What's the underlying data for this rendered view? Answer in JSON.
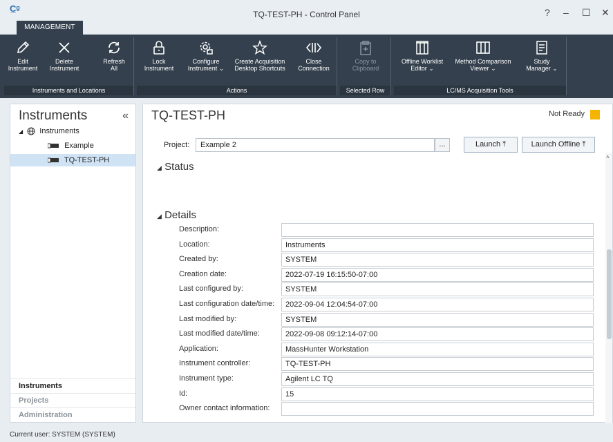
{
  "window": {
    "title": "TQ-TEST-PH - Control Panel",
    "help": "?",
    "minimize": "–",
    "maximize": "☐",
    "close": "✕"
  },
  "ribbon_tab": "MANAGEMENT",
  "ribbon": {
    "groups": [
      {
        "label": "Instruments and Locations"
      },
      {
        "label": "Actions"
      },
      {
        "label": "Selected Row"
      },
      {
        "label": "LC/MS Acquisition Tools"
      }
    ],
    "buttons": {
      "edit": [
        "Edit",
        "Instrument"
      ],
      "delete": [
        "Delete",
        "Instrument"
      ],
      "refresh": [
        "Refresh",
        "All"
      ],
      "lock": [
        "Lock",
        "Instrument"
      ],
      "configure": [
        "Configure",
        "Instrument ⌄"
      ],
      "shortcuts": [
        "Create Acquisition",
        "Desktop Shortcuts"
      ],
      "close_conn": [
        "Close",
        "Connection"
      ],
      "copy": [
        "Copy to",
        "Clipboard"
      ],
      "worklist": [
        "Offline Worklist",
        "Editor ⌄"
      ],
      "method_cmp": [
        "Method Comparison",
        "Viewer ⌄"
      ],
      "study": [
        "Study",
        "Manager ⌄"
      ]
    }
  },
  "left": {
    "title": "Instruments",
    "collapse": "«",
    "tree": {
      "root": "Instruments",
      "children": [
        "Example",
        "TQ-TEST-PH"
      ]
    },
    "nav": [
      "Instruments",
      "Projects",
      "Administration"
    ]
  },
  "main": {
    "title": "TQ-TEST-PH",
    "status": "Not Ready",
    "status_color": "#f5b400",
    "project_label": "Project:",
    "project_value": "Example 2",
    "browse": "...",
    "launch": "Launch ⤒",
    "launch_offline": "Launch Offline ⤒",
    "status_section": "Status",
    "details_section": "Details",
    "details": [
      {
        "label": "Description:",
        "value": ""
      },
      {
        "label": "Location:",
        "value": "Instruments"
      },
      {
        "label": "Created by:",
        "value": "SYSTEM"
      },
      {
        "label": "Creation date:",
        "value": "2022-07-19 16:15:50-07:00"
      },
      {
        "label": "Last configured by:",
        "value": "SYSTEM"
      },
      {
        "label": "Last configuration date/time:",
        "value": "2022-09-04 12:04:54-07:00"
      },
      {
        "label": "Last modified by:",
        "value": "SYSTEM"
      },
      {
        "label": "Last modified date/time:",
        "value": "2022-09-08 09:12:14-07:00"
      },
      {
        "label": "Application:",
        "value": "MassHunter Workstation"
      },
      {
        "label": "Instrument controller:",
        "value": "TQ-TEST-PH"
      },
      {
        "label": "Instrument type:",
        "value": "Agilent LC TQ"
      },
      {
        "label": "Id:",
        "value": "15"
      },
      {
        "label": "Owner contact information:",
        "value": ""
      }
    ]
  },
  "footer": "Current user: SYSTEM (SYSTEM)"
}
